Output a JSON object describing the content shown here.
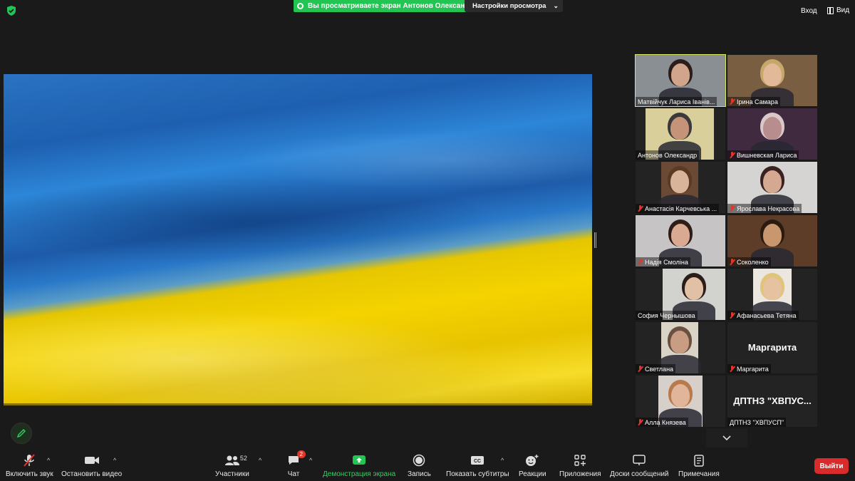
{
  "banner": {
    "sharing_text": "Вы просматриваете экран Антонов Олександр",
    "view_settings_label": "Настройки просмотра"
  },
  "header": {
    "enter_label": "Вход",
    "view_label": "Вид"
  },
  "participants": [
    {
      "name": "Матвійчук Лариса Іванів...",
      "muted": false,
      "active": true,
      "bg": "#8a8f94",
      "face": "#d1a58c",
      "hair": "#2b1e1a"
    },
    {
      "name": "Ірина Самара",
      "muted": true,
      "active": false,
      "bg": "#7a5e42",
      "face": "#e2b999",
      "hair": "#c8a76a"
    },
    {
      "name": "Антонов Олександр",
      "muted": false,
      "active": false,
      "bg": "#d8cf9a",
      "face": "#c49378",
      "hair": "#3a3a3a"
    },
    {
      "name": "Вишневская Лариса",
      "muted": true,
      "active": false,
      "bg": "#3f2a3f",
      "face": "#b88d8d",
      "hair": "#d8c8c8"
    },
    {
      "name": "Анастасія Карчевська ...",
      "muted": true,
      "active": false,
      "bg": "#6a4a35",
      "face": "#d8b49a",
      "hair": "#5a3a22"
    },
    {
      "name": "Ярослава Некрасова",
      "muted": true,
      "active": false,
      "bg": "#d6d4d2",
      "face": "#d5a892",
      "hair": "#3a2220"
    },
    {
      "name": "Надія Смоліна",
      "muted": true,
      "active": false,
      "bg": "#c6c4c4",
      "face": "#d9a992",
      "hair": "#2e1c18"
    },
    {
      "name": "Соколенко",
      "muted": true,
      "active": false,
      "bg": "#5d3d28",
      "face": "#c9976f",
      "hair": "#2a1a10"
    },
    {
      "name": "София Чернышова",
      "muted": false,
      "active": false,
      "bg": "#d2d2cf",
      "face": "#e2c0a6",
      "hair": "#2b1d18"
    },
    {
      "name": "Афанасьева Тетяна",
      "muted": true,
      "active": false,
      "bg": "#ece6e0",
      "face": "#e6c2a0",
      "hair": "#e0c47a"
    },
    {
      "name": "Светлана",
      "muted": true,
      "active": false,
      "bg": "#d9d4c6",
      "face": "#c99d84",
      "hair": "#6a5040"
    },
    {
      "name": "Маргарита",
      "muted": true,
      "active": false,
      "no_video": true,
      "display": "Маргарита"
    },
    {
      "name": "Алла Князева",
      "muted": true,
      "active": false,
      "bg": "#d7cfc9",
      "face": "#e0b59a",
      "hair": "#b87a4a"
    },
    {
      "name": "ДПТНЗ \"ХВПУСП\"",
      "muted": false,
      "active": false,
      "no_video": true,
      "display": "ДПТНЗ \"ХВПУС..."
    }
  ],
  "toolbar": {
    "unmute_label": "Включить звук",
    "stop_video_label": "Остановить видео",
    "participants_label": "Участники",
    "participants_count": "52",
    "chat_label": "Чат",
    "chat_badge": "2",
    "share_label": "Демонстрация экрана",
    "record_label": "Запись",
    "captions_label": "Показать субтитры",
    "reactions_label": "Реакции",
    "apps_label": "Приложения",
    "whiteboards_label": "Доски сообщений",
    "notes_label": "Примечания",
    "exit_label": "Выйти"
  },
  "colors": {
    "accent_green": "#23c552",
    "exit_red": "#d92b2b",
    "active_outline": "#d9e85a",
    "flag_blue": "#2a73c2",
    "flag_yellow": "#f4d300"
  }
}
